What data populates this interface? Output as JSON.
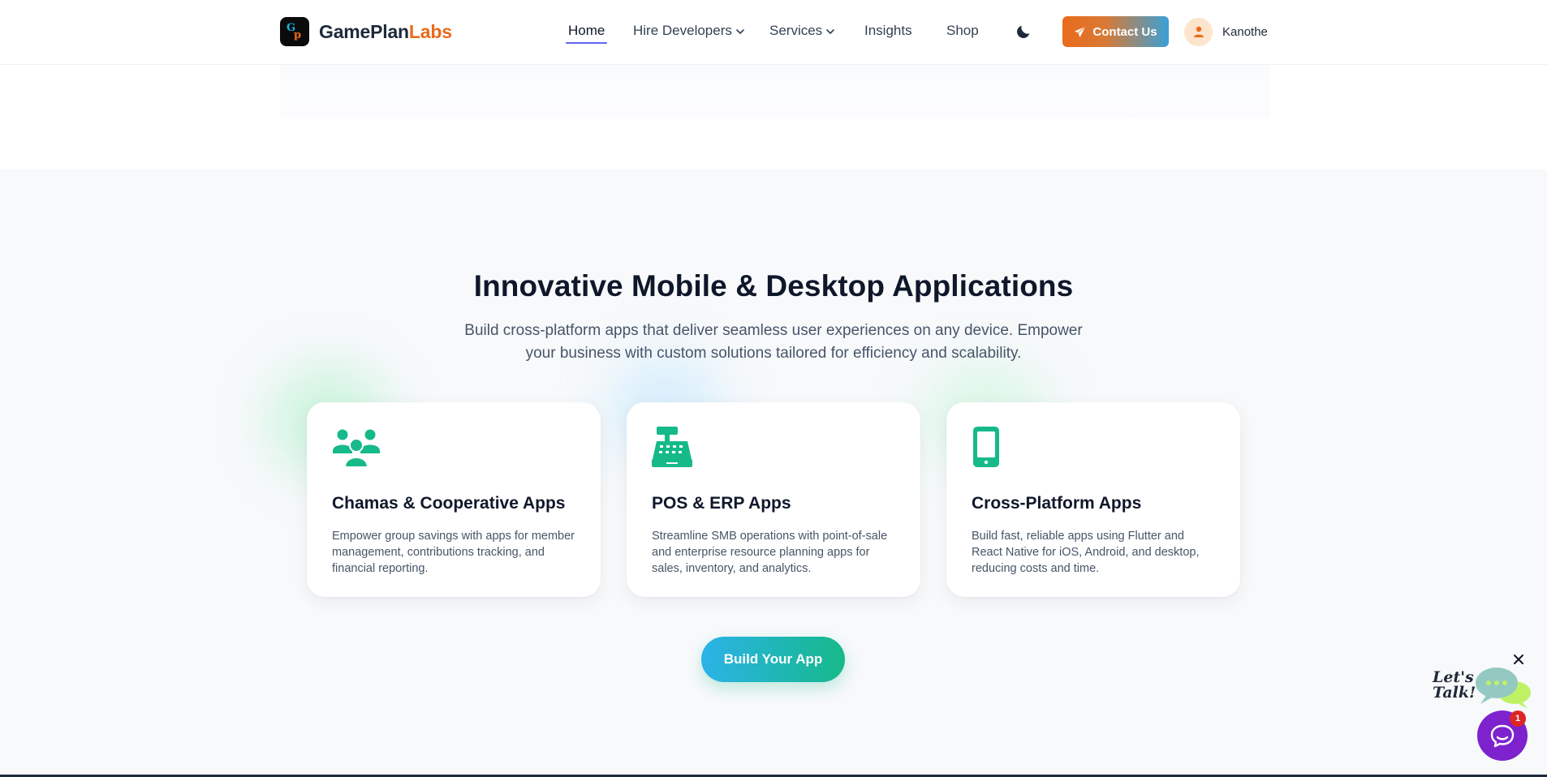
{
  "header": {
    "logo": {
      "mark_g": "G",
      "mark_p": "p",
      "name_part1": "GamePlan",
      "name_part2": "Labs"
    },
    "nav": [
      {
        "label": "Home",
        "active": true
      },
      {
        "label": "Hire Developers",
        "dropdown": true
      },
      {
        "label": "Services",
        "dropdown": true
      },
      {
        "label": "Insights"
      },
      {
        "label": "Shop"
      }
    ],
    "theme_icon": "moon-icon",
    "contact_label": "Contact Us",
    "contact_icon": "paper-plane-icon",
    "user_name": "Kanothe",
    "user_icon": "user-icon"
  },
  "section": {
    "title": "Innovative Mobile & Desktop Applications",
    "subtitle": "Build cross-platform apps that deliver seamless user experiences on any device. Empower your business with custom solutions tailored for efficiency and scalability.",
    "cards": [
      {
        "icon": "users-group-icon",
        "title": "Chamas & Cooperative Apps",
        "description": "Empower group savings with apps for member management, contributions tracking, and financial reporting."
      },
      {
        "icon": "cash-register-icon",
        "title": "POS & ERP Apps",
        "description": "Streamline SMB operations with point-of-sale and enterprise resource planning apps for sales, inventory, and analytics."
      },
      {
        "icon": "mobile-phone-icon",
        "title": "Cross-Platform Apps",
        "description": "Build fast, reliable apps using Flutter and React Native for iOS, Android, and desktop, reducing costs and time."
      }
    ],
    "cta_label": "Build Your App"
  },
  "chat": {
    "lets_talk": "Let's Talk!",
    "badge_count": "1",
    "close_icon": "close-icon",
    "launcher_icon": "chat-bubble-icon"
  },
  "colors": {
    "brand_orange": "#ea6b1c",
    "accent_green": "#16b98a",
    "accent_blue": "#2bb3e8",
    "nav_underline": "#6366f1",
    "chat_purple": "#7e22ce"
  }
}
